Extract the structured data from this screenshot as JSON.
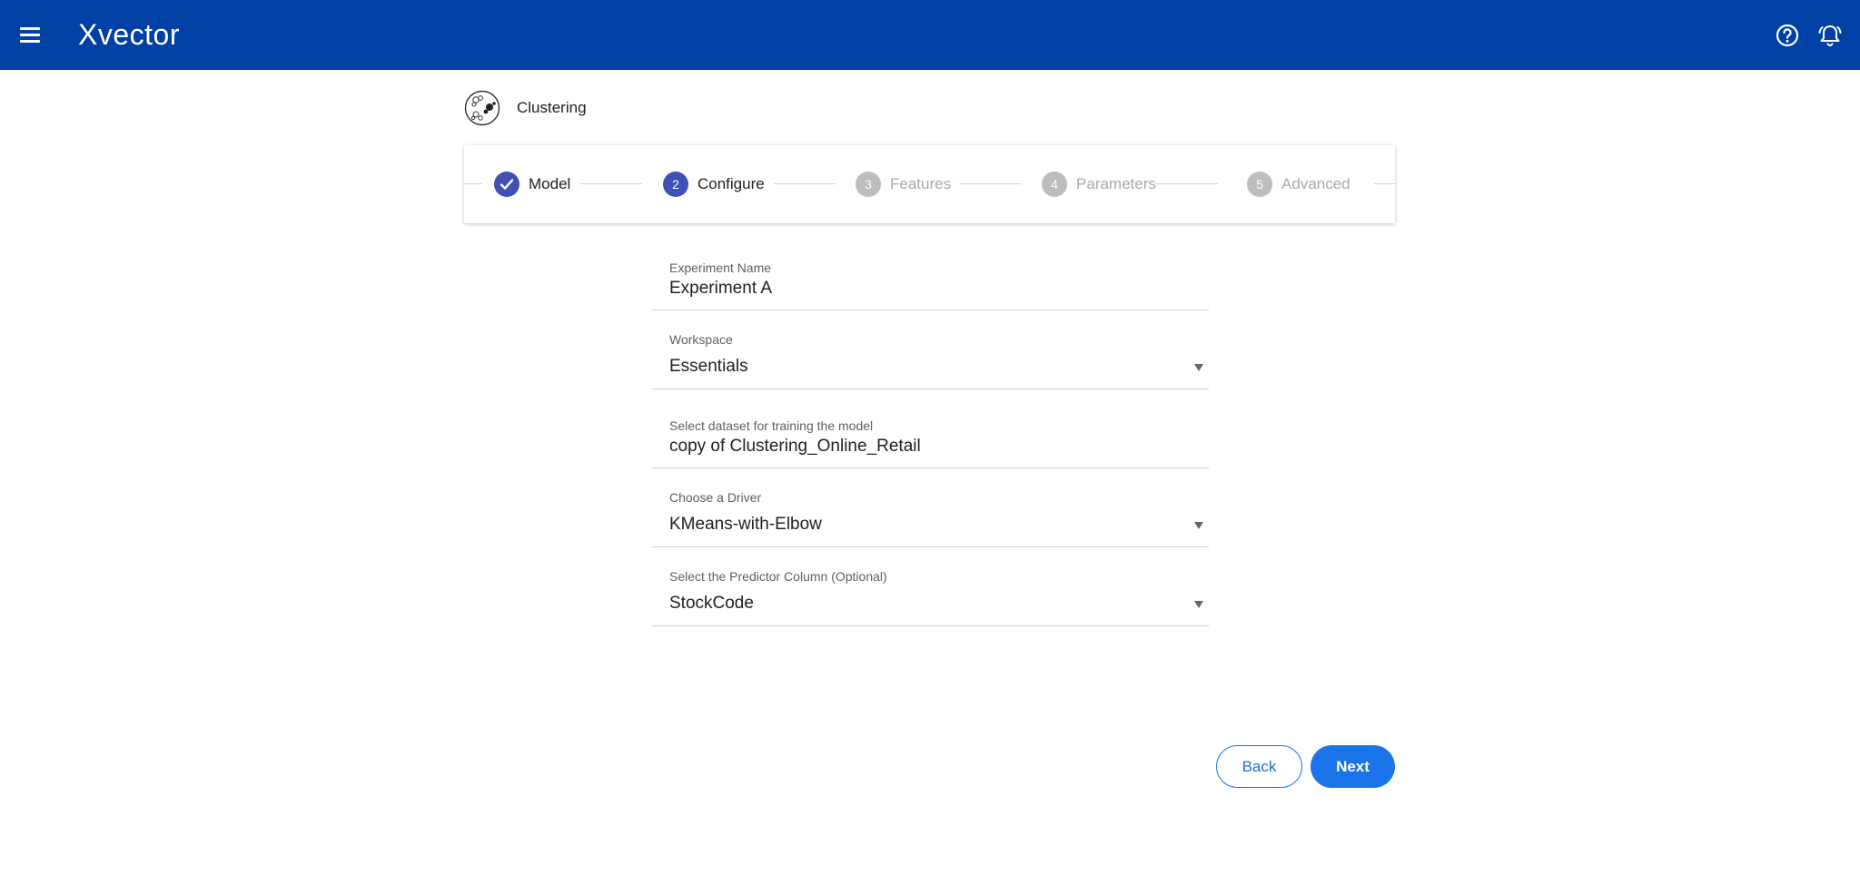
{
  "app": {
    "brand": "Xvector"
  },
  "page": {
    "title": "Clustering"
  },
  "stepper": {
    "steps": [
      {
        "number": "",
        "label": "Model",
        "state": "completed"
      },
      {
        "number": "2",
        "label": "Configure",
        "state": "active"
      },
      {
        "number": "3",
        "label": "Features",
        "state": "inactive"
      },
      {
        "number": "4",
        "label": "Parameters",
        "state": "inactive"
      },
      {
        "number": "5",
        "label": "Advanced",
        "state": "inactive"
      }
    ]
  },
  "form": {
    "experiment_name": {
      "label": "Experiment Name",
      "value": "Experiment A"
    },
    "workspace": {
      "label": "Workspace",
      "value": "Essentials"
    },
    "dataset": {
      "label": "Select dataset for training the model",
      "value": "copy of Clustering_Online_Retail"
    },
    "driver": {
      "label": "Choose a Driver",
      "value": "KMeans-with-Elbow"
    },
    "predictor": {
      "label": "Select the Predictor Column (Optional)",
      "value": "StockCode"
    }
  },
  "actions": {
    "back_label": "Back",
    "next_label": "Next"
  },
  "icons": {
    "menu": "menu-icon",
    "help": "help-circle-icon",
    "notifications": "bell-alert-icon",
    "clustering": "clustering-icon",
    "completed": "check-icon",
    "dropdown": "caret-down-icon"
  },
  "colors": {
    "topbar": "#0141a6",
    "step_active": "#3f51b5",
    "step_inactive": "#bdbdbd",
    "primary_button": "#1a73e8"
  }
}
